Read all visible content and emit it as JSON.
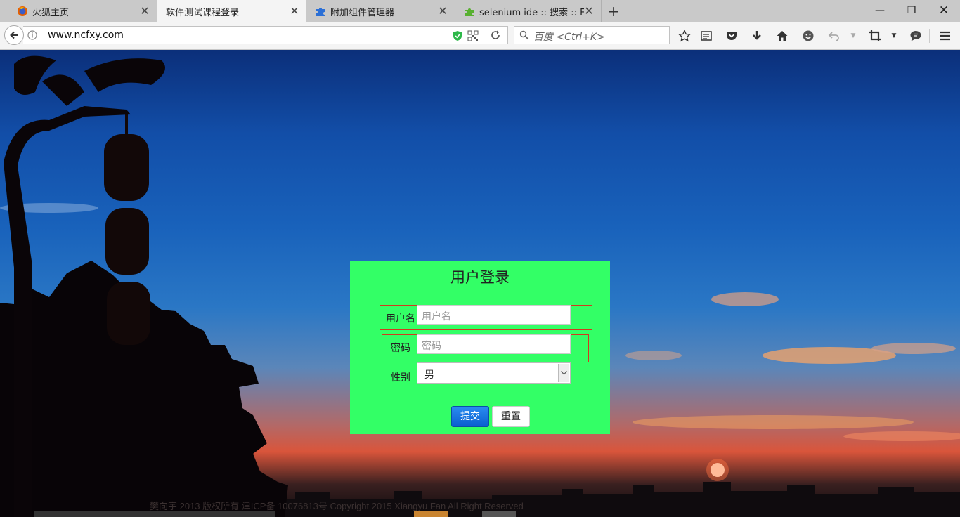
{
  "tabs": [
    {
      "title": "火狐主页",
      "icon": "firefox-icon",
      "active": false
    },
    {
      "title": "软件测试课程登录",
      "icon": "none",
      "active": true
    },
    {
      "title": "附加组件管理器",
      "icon": "puzzle-icon",
      "active": false
    },
    {
      "title": "selenium ide :: 搜索 :: Fir...",
      "icon": "addon-icon",
      "active": false
    }
  ],
  "navbar": {
    "url": "www.ncfxy.com",
    "search_placeholder": "百度 <Ctrl+K>"
  },
  "login": {
    "title": "用户登录",
    "username_label": "用户名",
    "username_placeholder": "用户名",
    "password_label": "密码",
    "password_placeholder": "密码",
    "gender_label": "性别",
    "gender_value": "男",
    "submit_label": "提交",
    "reset_label": "重置"
  },
  "footer": {
    "copyright": "樊向宇 2013 版权所有 津ICP备 10076813号 Copyright 2015 Xiangyu Fan All Right Reserved"
  },
  "colors": {
    "login_bg": "#33ff66",
    "highlight_border": "#d23a1e",
    "submit_bg": "#0a5fd0"
  }
}
